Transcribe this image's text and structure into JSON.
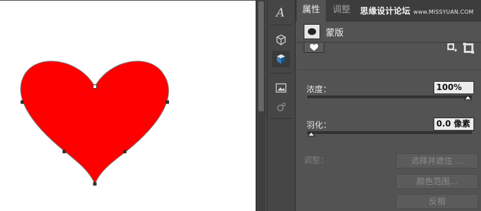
{
  "panel": {
    "tabs": [
      {
        "label": "属性"
      },
      {
        "label": "调整"
      }
    ],
    "watermark": {
      "main": "思缘设计论坛",
      "site": "www.MISSYUAN.COM"
    },
    "mask_title": "蒙版",
    "density": {
      "label": "浓度：",
      "value": "100%",
      "fraction": 1.0
    },
    "feather": {
      "label": "羽化：",
      "value": "0.0 像素",
      "fraction": 0.0
    },
    "adjust_label": "调整：",
    "buttons": {
      "select_mask": "选择并遮住 ...",
      "color_range": "颜色范围...",
      "invert": "反相"
    }
  },
  "colors": {
    "heart_fill": "#ff0000",
    "canvas_bg": "#ffffff",
    "panel_bg": "#535353"
  },
  "icons": {
    "tool_1": "type-glyph-icon",
    "tool_2": "3d-cube-outline-icon",
    "tool_3": "3d-cube-solid-icon",
    "tool_4": "image-frame-icon",
    "tool_5": "gear-connect-icon"
  }
}
